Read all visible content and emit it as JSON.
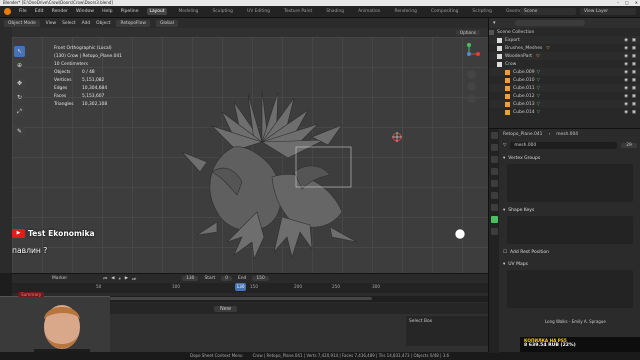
{
  "window": {
    "title": "Blender* [E:\\OneDrive\\Crow\\Doors\\Crow\\Doors3.blend]",
    "controls": [
      "–",
      "□",
      "✕"
    ]
  },
  "menubar": {
    "items": [
      "File",
      "Edit",
      "Render",
      "Window",
      "Help",
      "Pipeline"
    ],
    "workspaces": [
      "Layout",
      "Modeling",
      "Sculpting",
      "UV Editing",
      "Texture Paint",
      "Shading",
      "Animation",
      "Rendering",
      "Compositing",
      "Scripting",
      "Geometry Nodes"
    ],
    "active_workspace": "Layout",
    "scene": "Scene",
    "view_layer": "View Layer"
  },
  "viewport_header": {
    "mode": "Object Mode",
    "menus": [
      "View",
      "Select",
      "Add",
      "Object"
    ],
    "addon": "RetopoFlow",
    "orientation": "Global",
    "options_label": "Options"
  },
  "stats": {
    "view": "Front Orthographic (Local)",
    "object": "(130) Crow | Retopo_Plane.041",
    "scale": "10 Centimeters",
    "rows": [
      {
        "label": "Objects",
        "value": "0 / 48"
      },
      {
        "label": "Vertices",
        "value": "5,151,082"
      },
      {
        "label": "Edges",
        "value": "10,304,684"
      },
      {
        "label": "Faces",
        "value": "5,153,607"
      },
      {
        "label": "Triangles",
        "value": "10,302,108"
      }
    ]
  },
  "overlay": {
    "channel": "Test Ekonomika",
    "chat": "павлин ?",
    "summary_tag": "Summary"
  },
  "timeline": {
    "menu": "Marker",
    "current_frame": "130",
    "start_label": "Start",
    "start": "0",
    "end_label": "End",
    "end": "150",
    "ticks": [
      "50",
      "100",
      "150",
      "200",
      "250",
      "300"
    ],
    "cursor": "130"
  },
  "bottombar": {
    "new_label": "New",
    "select_box": "Select Box"
  },
  "outliner": {
    "title": "Scene Collection",
    "rows": [
      {
        "label": "Export",
        "type": "collection",
        "verts": "",
        "tris": ""
      },
      {
        "label": "Brushes_Meshes",
        "type": "collection",
        "verts": "",
        "tris": ""
      },
      {
        "label": "WoodenPart",
        "type": "collection",
        "verts": "",
        "tris": ""
      },
      {
        "label": "Crow",
        "type": "collection",
        "verts": "",
        "tris": ""
      },
      {
        "label": "Cube.009",
        "type": "mesh",
        "verts": "",
        "tris": ""
      },
      {
        "label": "Cube.010",
        "type": "mesh",
        "verts": "",
        "tris": ""
      },
      {
        "label": "Cube.011",
        "type": "mesh",
        "verts": "",
        "tris": ""
      },
      {
        "label": "Cube.012",
        "type": "mesh",
        "verts": "",
        "tris": ""
      },
      {
        "label": "Cube.013",
        "type": "mesh",
        "verts": "",
        "tris": ""
      },
      {
        "label": "Cube.014",
        "type": "mesh",
        "verts": "",
        "tris": ""
      }
    ]
  },
  "properties": {
    "breadcrumb_object": "Retopo_Plane.041",
    "breadcrumb_mesh": "mesh.004",
    "mesh_name": "mesh.004",
    "users": "29",
    "panels": [
      {
        "label": "Vertex Groups"
      },
      {
        "label": "Shape Keys"
      },
      {
        "label": "Add Rest Position"
      },
      {
        "label": "UV Maps"
      }
    ],
    "uv_caption": "Long Walks - Emily A. Sprague"
  },
  "status": {
    "left": "Dope Sheet Context Menu",
    "center": "Crow | Retopo_Plane.041 | Verts 7,420,914 | Faces 7,436,489 | Tris 14,831,473 | Objects 0/48 | 3.6"
  },
  "donation": {
    "line1": "КОПИЛКА НА PS5",
    "line2": "8 639.54 RUB (22%)"
  },
  "colors": {
    "accent": "#4772b3",
    "orange": "#e87d0d",
    "youtube": "#e41b1b"
  }
}
